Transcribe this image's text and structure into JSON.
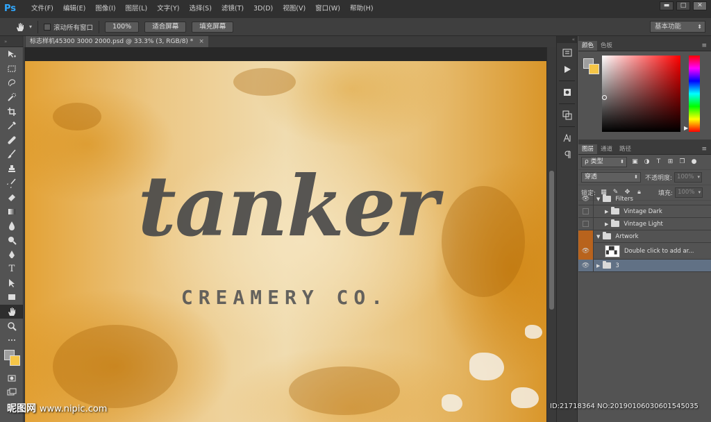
{
  "app": {
    "logo": "Ps",
    "menu": [
      "文件(F)",
      "编辑(E)",
      "图像(I)",
      "图层(L)",
      "文字(Y)",
      "选择(S)",
      "滤镜(T)",
      "3D(D)",
      "视图(V)",
      "窗口(W)",
      "帮助(H)"
    ],
    "window_buttons": {
      "minimize": "▬",
      "maximize": "□",
      "close": "✕"
    }
  },
  "options": {
    "scroll_all_label": "滚动所有窗口",
    "btn_100": "100%",
    "btn_fit": "适合屏幕",
    "btn_fill": "填充屏幕",
    "workspace": "基本功能"
  },
  "document": {
    "tab_title": "标志样机45300 3000 2000.psd @ 33.3% (3, RGB/8) *",
    "tab_close": "×",
    "artwork_main": "tanker",
    "artwork_sub": "CREAMERY CO."
  },
  "tools": [
    "move-icon",
    "marquee-icon",
    "lasso-icon",
    "quick-select-icon",
    "crop-icon",
    "eyedropper-icon",
    "healing-icon",
    "brush-icon",
    "clone-stamp-icon",
    "history-brush-icon",
    "eraser-icon",
    "gradient-icon",
    "blur-icon",
    "dodge-icon",
    "pen-icon",
    "type-icon",
    "path-select-icon",
    "rectangle-icon",
    "hand-icon",
    "zoom-icon"
  ],
  "type_tool_glyph": "T",
  "colors": {
    "foreground": "#9e9e9e",
    "background": "#f5c547",
    "accent_layer": "#b8631d",
    "selected_layer": "#617185"
  },
  "panels": {
    "color_tabs": [
      "颜色",
      "色板"
    ],
    "layers_tabs": [
      "图层",
      "通道",
      "路径"
    ],
    "filter_kind": "ρ 类型",
    "blend_mode": "穿透",
    "opacity_label": "不透明度:",
    "opacity_value": "100%",
    "lock_label": "锁定:",
    "fill_label": "填充:",
    "fill_value": "100%",
    "menu_glyph": "≡"
  },
  "layers": [
    {
      "name": "Filters",
      "type": "group",
      "expanded": true,
      "visible": true
    },
    {
      "name": "Vintage Dark",
      "type": "group",
      "expanded": false,
      "visible": false
    },
    {
      "name": "Vintage Light",
      "type": "group",
      "expanded": false,
      "visible": false
    },
    {
      "name": "Artwork",
      "type": "group",
      "expanded": true,
      "visible": false
    },
    {
      "name": "Double click to add ar...",
      "type": "smart-object",
      "visible": true
    },
    {
      "name": "3",
      "type": "group",
      "expanded": false,
      "visible": true,
      "selected": true
    }
  ],
  "watermark": {
    "brand": "昵图网",
    "url": "www.nipic.com",
    "id_text": "ID:21718364 NO:20190106030601545035"
  }
}
